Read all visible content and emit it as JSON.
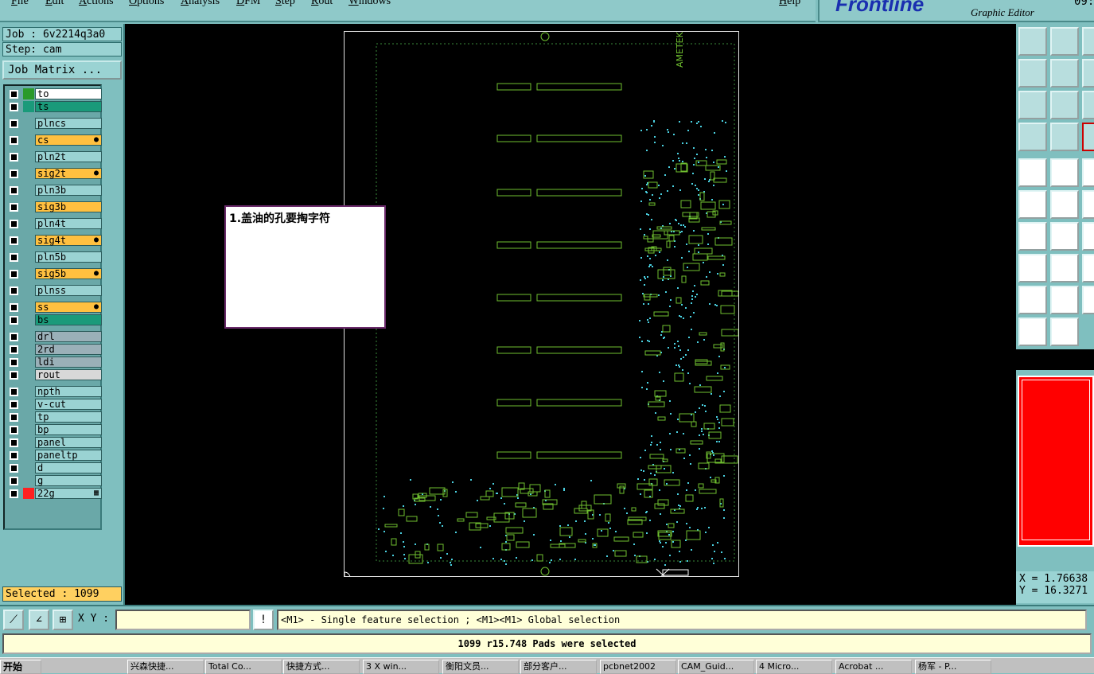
{
  "menu": {
    "items": [
      "File",
      "Edit",
      "Actions",
      "Options",
      "Analysis",
      "DFM",
      "Step",
      "Rout",
      "Windows"
    ],
    "help": "Help"
  },
  "brand": {
    "logo": "Frontline",
    "subtitle": "Graphic Editor",
    "time": "09:"
  },
  "job": {
    "job_label": "Job : 6v2214q3a0",
    "step_label": "Step: cam",
    "matrix_button": "Job Matrix ..."
  },
  "layers": [
    {
      "name": "to",
      "color": "#ffffff",
      "swatch": "#2a9a2a"
    },
    {
      "name": "ts",
      "color": "#1a9a7a",
      "swatch": "#1a9a7a"
    },
    {
      "name": "plncs",
      "color": "#9ad3d3",
      "swatch": ""
    },
    {
      "name": "cs",
      "color": "#ffc040",
      "swatch": "",
      "mark": "●"
    },
    {
      "name": "pln2t",
      "color": "#9ad3d3",
      "swatch": ""
    },
    {
      "name": "sig2t",
      "color": "#ffc040",
      "swatch": "",
      "mark": "●"
    },
    {
      "name": "pln3b",
      "color": "#9ad3d3",
      "swatch": ""
    },
    {
      "name": "sig3b",
      "color": "#ffc040",
      "swatch": ""
    },
    {
      "name": "pln4t",
      "color": "#9ad3d3",
      "swatch": ""
    },
    {
      "name": "sig4t",
      "color": "#ffc040",
      "swatch": "",
      "mark": "●"
    },
    {
      "name": "pln5b",
      "color": "#9ad3d3",
      "swatch": ""
    },
    {
      "name": "sig5b",
      "color": "#ffc040",
      "swatch": "",
      "mark": "●"
    },
    {
      "name": "plnss",
      "color": "#9ad3d3",
      "swatch": ""
    },
    {
      "name": "ss",
      "color": "#ffc040",
      "swatch": "",
      "mark": "●"
    },
    {
      "name": "bs",
      "color": "#1a9a7a",
      "swatch": ""
    },
    {
      "name": "drl",
      "color": "#9ab0b8",
      "swatch": ""
    },
    {
      "name": "2rd",
      "color": "#9ab0b8",
      "swatch": ""
    },
    {
      "name": "ldi",
      "color": "#9ab0b8",
      "swatch": ""
    },
    {
      "name": "rout",
      "color": "#d8d8d8",
      "swatch": ""
    },
    {
      "name": "npth",
      "color": "#9ad3d3",
      "swatch": ""
    },
    {
      "name": "v-cut",
      "color": "#9ad3d3",
      "swatch": ""
    },
    {
      "name": "tp",
      "color": "#9ad3d3",
      "swatch": ""
    },
    {
      "name": "bp",
      "color": "#9ad3d3",
      "swatch": ""
    },
    {
      "name": "panel",
      "color": "#9ad3d3",
      "swatch": ""
    },
    {
      "name": "paneltp",
      "color": "#9ad3d3",
      "swatch": ""
    },
    {
      "name": "d",
      "color": "#9ad3d3",
      "swatch": ""
    },
    {
      "name": "g",
      "color": "#9ad3d3",
      "swatch": ""
    },
    {
      "name": "22g",
      "color": "#9ad3d3",
      "swatch": "#ff2020",
      "mark": "▦"
    }
  ],
  "selected_label": "Selected : 1099",
  "note": {
    "text": "1.盖油的孔要掏字符"
  },
  "coords": {
    "x": "X = 1.76638",
    "y": "Y = 16.3271"
  },
  "cmd": {
    "xy_label": "X Y :",
    "xy_value": "",
    "hint": "<M1> - Single feature selection ; <M1><M1> Global selection"
  },
  "status": "1099 r15.748 Pads were selected",
  "taskbar": {
    "start": "开始",
    "tasks": [
      "兴森快捷...",
      "Total Co...",
      "快捷方式...",
      "3 X win...",
      "衡阳文员...",
      "部分客户...",
      "pcbnet2002",
      "CAM_Guid...",
      "4 Micro...",
      "Acrobat ...",
      "杨军 - P..."
    ]
  }
}
